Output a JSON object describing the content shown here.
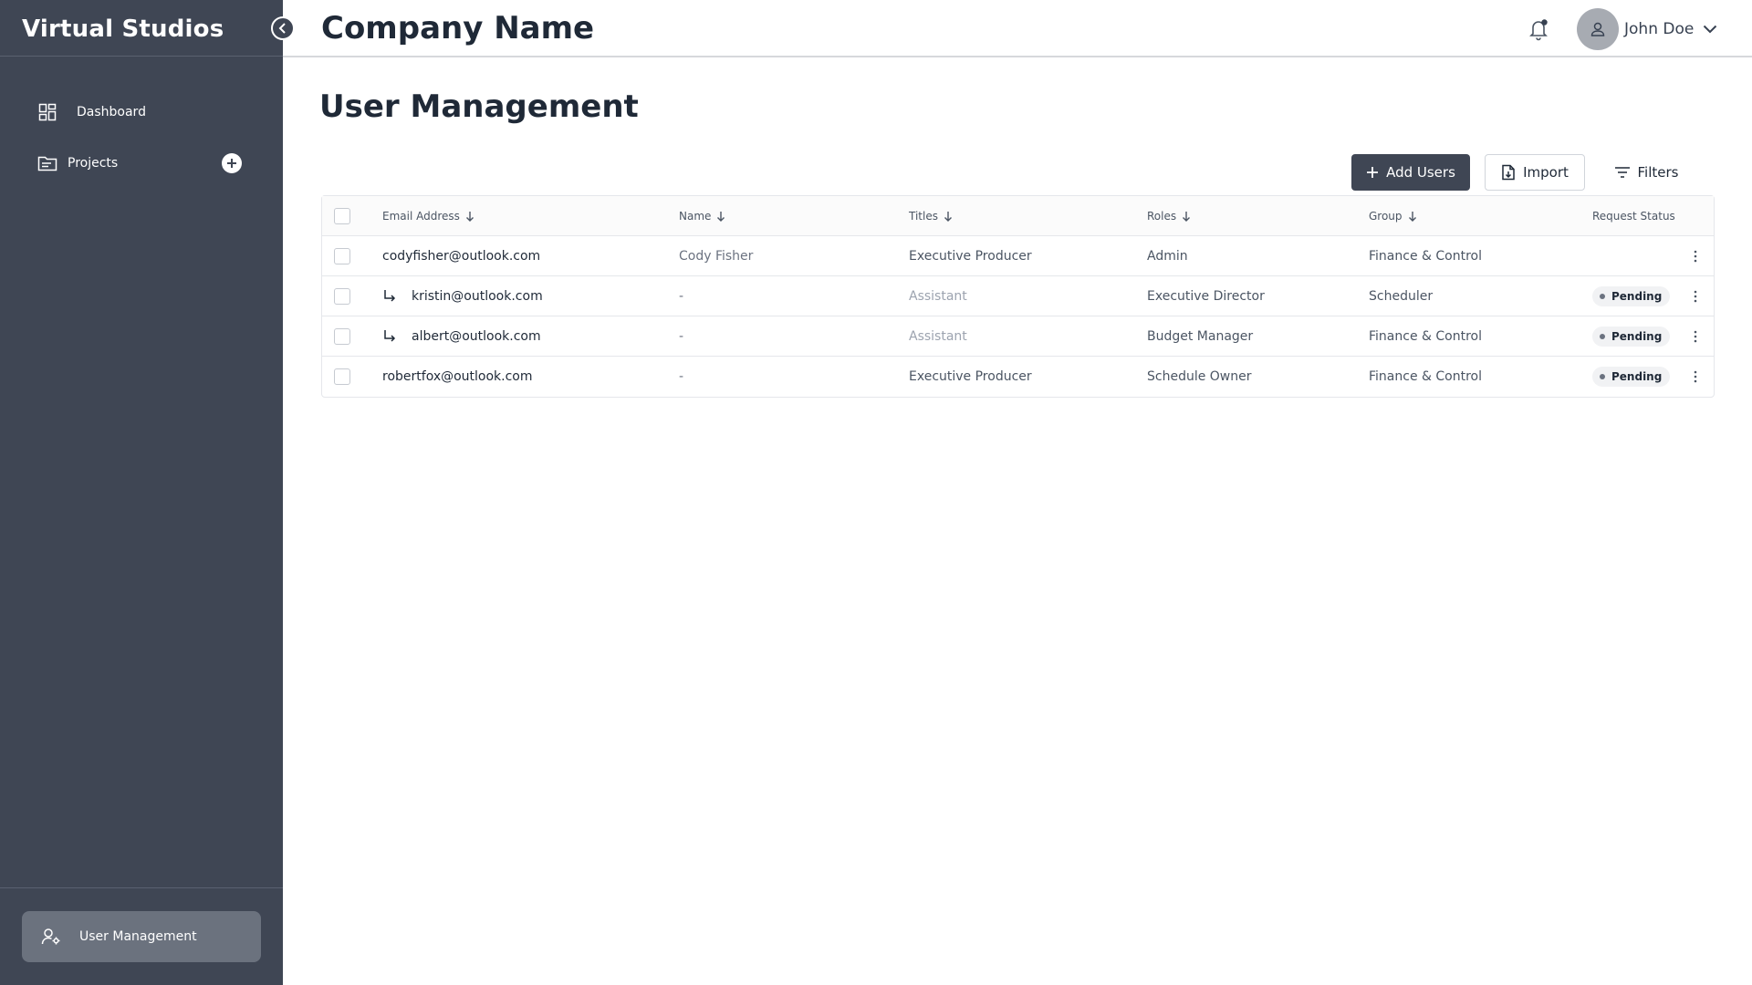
{
  "sidebar": {
    "brand": "Virtual Studios",
    "items": [
      {
        "label": "Dashboard",
        "icon": "dashboard-grid-icon"
      },
      {
        "label": "Projects",
        "icon": "folder-icon"
      }
    ],
    "bottom_item": {
      "label": "User Management",
      "icon": "user-settings-icon"
    }
  },
  "header": {
    "company": "Company Name",
    "user_name": "John Doe"
  },
  "main": {
    "title": "User Management",
    "actions": {
      "add_users": "Add Users",
      "import": "Import",
      "filters": "Filters"
    },
    "table": {
      "columns": [
        "Email Address",
        "Name",
        "Titles",
        "Roles",
        "Group",
        "Request Status"
      ],
      "rows": [
        {
          "email": "codyfisher@outlook.com",
          "name": "Cody Fisher",
          "title": "Executive Producer",
          "role": "Admin",
          "group": "Finance & Control",
          "status": "",
          "sub": false
        },
        {
          "email": "kristin@outlook.com",
          "name": "-",
          "title": "Assistant",
          "role": "Executive Director",
          "group": "Scheduler",
          "status": "Pending",
          "sub": true
        },
        {
          "email": "albert@outlook.com",
          "name": "-",
          "title": "Assistant",
          "role": "Budget Manager",
          "group": "Finance & Control",
          "status": "Pending",
          "sub": true
        },
        {
          "email": "robertfox@outlook.com",
          "name": "-",
          "title": "Executive Producer",
          "role": "Schedule Owner",
          "group": "Finance & Control",
          "status": "Pending",
          "sub": false
        }
      ]
    }
  },
  "colors": {
    "sidebar_bg": "#3f4654",
    "sidebar_active": "#6b727e",
    "primary_button": "#3f4654",
    "badge_bg": "#f1f2f4"
  }
}
